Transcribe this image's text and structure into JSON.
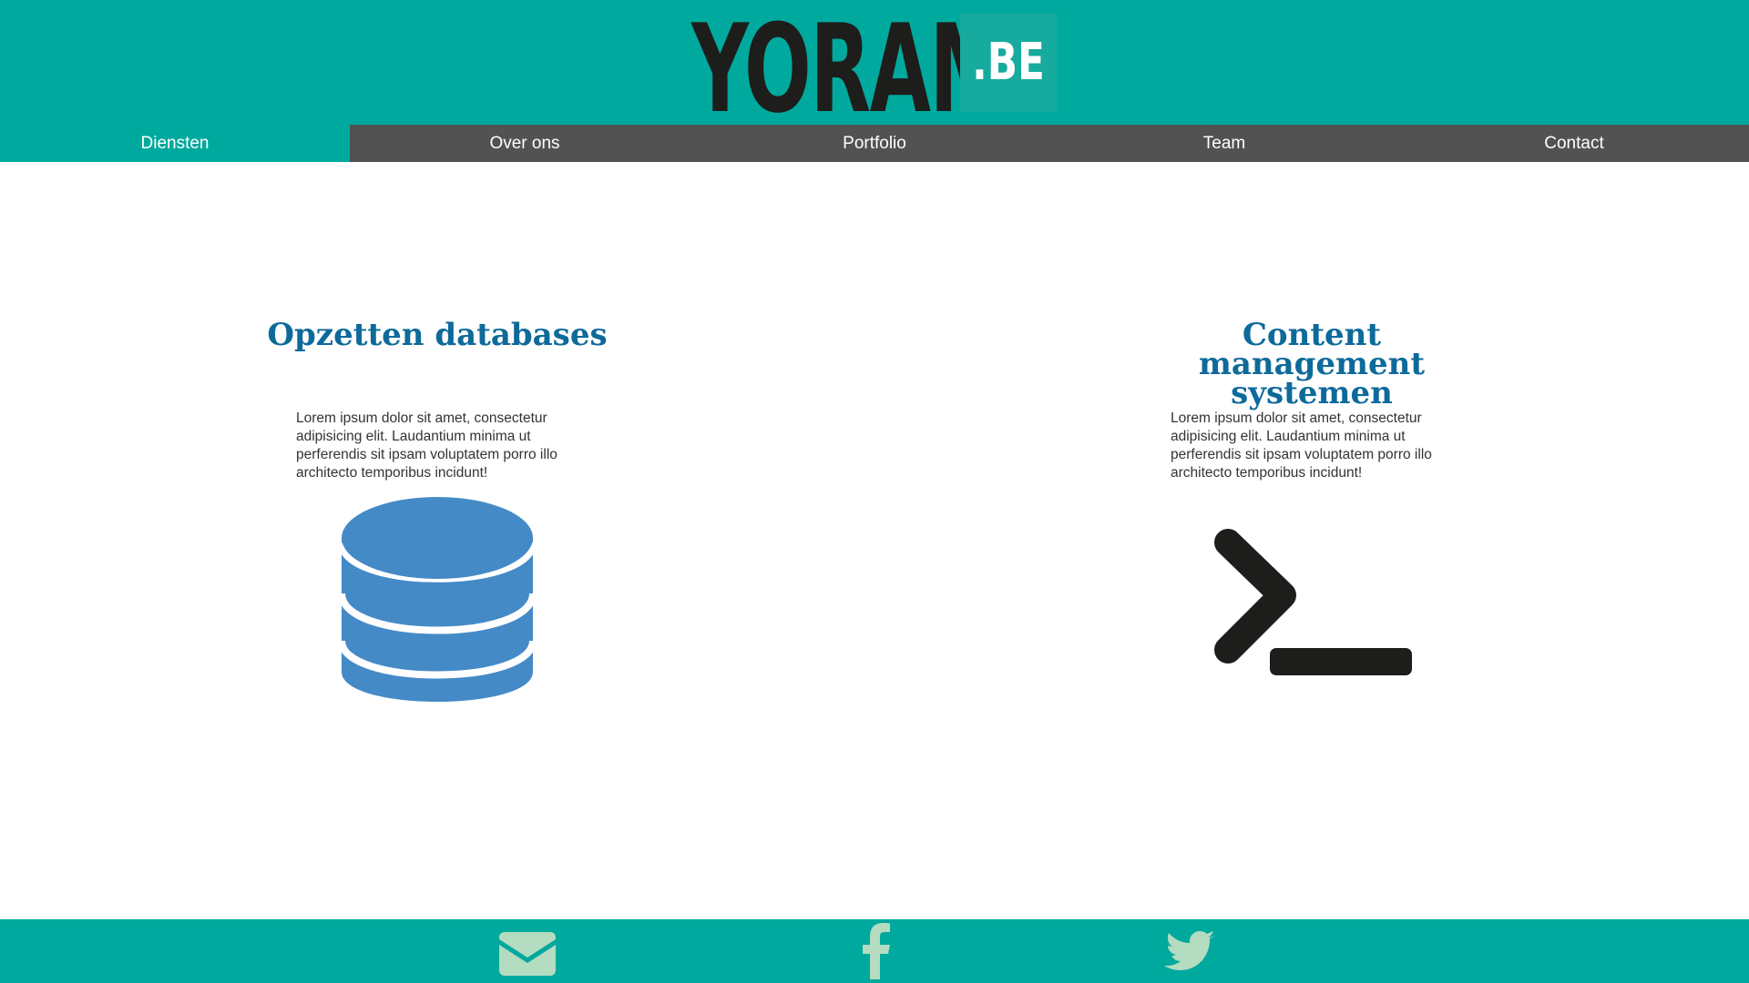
{
  "header": {
    "logo_word": "YORAM",
    "logo_tld": ".BE",
    "colors": {
      "bar": "#00a99d",
      "logo_dark": "#1d1d1b"
    }
  },
  "nav": {
    "items": [
      {
        "label": "Diensten",
        "active": true
      },
      {
        "label": "Over ons",
        "active": false
      },
      {
        "label": "Portfolio",
        "active": false
      },
      {
        "label": "Team",
        "active": false
      },
      {
        "label": "Contact",
        "active": false
      }
    ],
    "colors": {
      "active": "#00a99d",
      "inactive": "#525252"
    }
  },
  "services": [
    {
      "title": "Opzetten databases",
      "text": "Lorem ipsum dolor sit amet, consectetur adipisicing elit. Laudantium minima ut perferendis sit ipsam voluptatem porro illo architecto temporibus incidunt!",
      "icon": "database-icon"
    },
    {
      "title": "Content management systemen",
      "text": "Lorem ipsum dolor sit amet, consectetur adipisicing elit. Laudantium minima ut perferendis sit ipsam voluptatem porro illo architecto temporibus incidunt!",
      "icon": "terminal-icon"
    }
  ],
  "footer": {
    "icons": [
      "mail-icon",
      "facebook-icon",
      "twitter-icon"
    ],
    "colors": {
      "bar": "#00a99d",
      "icon": "#b3dcc0"
    }
  },
  "colors": {
    "title": "#0d6a9a",
    "database": "#448ac7",
    "terminal": "#1d1d1b"
  }
}
